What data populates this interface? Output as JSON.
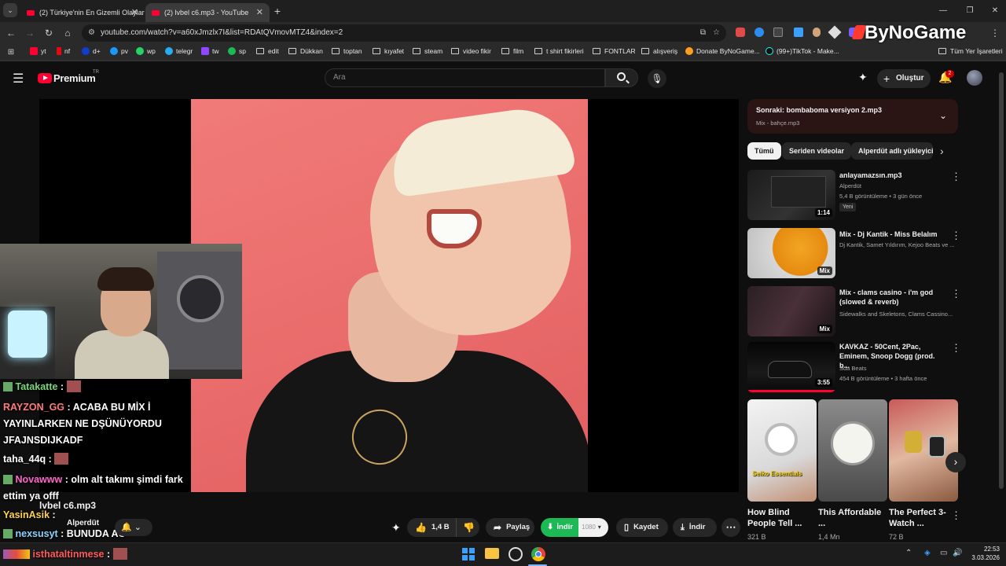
{
  "tabs": [
    {
      "title": "(2) Türkiye'nin En Gizemli Olaylar"
    },
    {
      "title": "(2) lvbel c6.mp3 - YouTube"
    }
  ],
  "new_tab": "+",
  "window_controls": {
    "minimize": "—",
    "restore": "❐",
    "close": "✕"
  },
  "address": {
    "url": "youtube.com/watch?v=a60xJmzlx7I&list=RDAtQVmovMTZ4&index=2"
  },
  "overlay_logo": "ByNoGame",
  "bookmarks": [
    "yt",
    "nf",
    "d+",
    "pv",
    "wp",
    "telegr",
    "tw",
    "sp",
    "edit",
    "Dükkan",
    "toptan",
    "kıyafet",
    "steam",
    "video fikir",
    "film",
    "t shirt fikirleri",
    "FONTLAR",
    "alışveriş",
    "Donate ByNoGame...",
    "(99+)TikTok - Make..."
  ],
  "all_bookmarks": "Tüm Yer İşaretleri",
  "youtube": {
    "logo": "Premium",
    "logo_sup": "TR",
    "search_placeholder": "Ara",
    "create_label": "Oluştur",
    "notif_count": "2"
  },
  "chat": [
    {
      "user": "Tatakatte",
      "msg": "",
      "color": "#7ad67a"
    },
    {
      "user": "RAYZON_GG",
      "msg": "ACABA BU MİX İ YAYINLARKEN NE DŞÜNÜYORDU JFAJNSDIJKADF",
      "color": "#ff7a7a"
    },
    {
      "user": "taha_44q",
      "msg": "",
      "color": "#ffffff"
    },
    {
      "user": "Novawww",
      "msg": "olm alt takımı şimdi fark ettim ya offf",
      "color": "#ff66cc"
    },
    {
      "user": "YasinAsik",
      "msg": "",
      "color": "#ffd24d"
    },
    {
      "user": "nexsusyt",
      "msg": "BUNUDA AC",
      "color": "#8fd0ff"
    },
    {
      "user": "isthataltinmese",
      "msg": "",
      "color": "#ff5a5a"
    }
  ],
  "video": {
    "title": "lvbel c6.mp3",
    "channel": "Alperdüt",
    "likes": "1,4 B",
    "share": "Paylaş",
    "download_green": "İndir",
    "quality": "1080",
    "save": "Kaydet",
    "download": "İndir"
  },
  "next": {
    "label": "Sonraki: bombaboma versiyon 2.mp3",
    "sub": "Mix - bahçe.mp3"
  },
  "chips": [
    "Tümü",
    "Seriden videolar",
    "Alperdüt adlı yükleyici"
  ],
  "related": [
    {
      "title": "anlayamazsın.mp3",
      "channel": "Alperdüt",
      "meta": "5,4 B görüntüleme • 3 gün önce",
      "badge": "Yeni",
      "duration": "1:14"
    },
    {
      "title": "Mix - Dj Kantik - Miss Belalım",
      "channel": "Dj Kantik, Samet Yıldırım, Kejoo Beats ve ...",
      "meta": "",
      "badge": "",
      "duration": "Mix"
    },
    {
      "title": "Mix - clams casino - i'm god (slowed & reverb)",
      "channel": "Sidewalks and Skeletons, Clams Cassino...",
      "meta": "",
      "badge": "",
      "duration": "Mix"
    },
    {
      "title": "KAVKAZ - 50Cent, 2Pac, Eminem, Snoop Dogg (prod. b...",
      "channel": "Sda Beats",
      "meta": "454 B görüntüleme • 3 hafta önce",
      "badge": "",
      "duration": "3:55"
    }
  ],
  "shorts": [
    {
      "title": "How Blind People Tell ...",
      "views": "321 B"
    },
    {
      "title": "This Affordable ...",
      "views": "1,4 Mn"
    },
    {
      "title": "The Perfect 3-Watch ...",
      "views": "72 B"
    }
  ],
  "short_overlay": "Seiko Essentials",
  "taskbar": {
    "time": "22:53",
    "date": "3.03.2026"
  },
  "colors": {
    "accent_red": "#ff0033",
    "download_green": "#1db954"
  }
}
